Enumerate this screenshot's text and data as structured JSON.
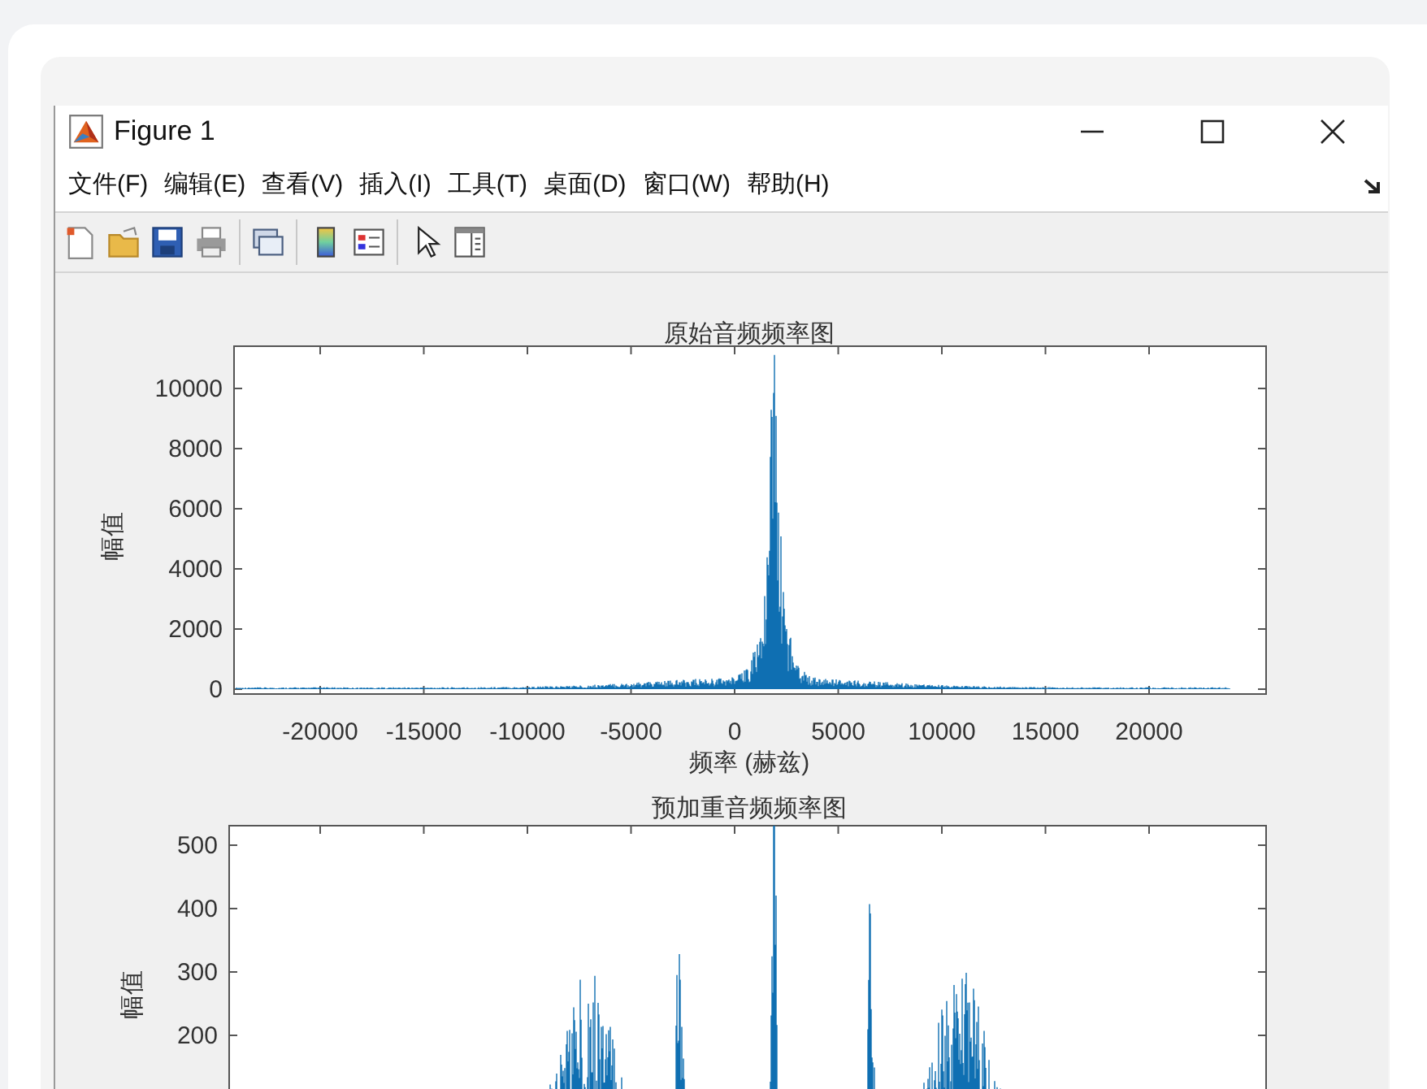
{
  "window": {
    "title": "Figure 1"
  },
  "menu": [
    {
      "label": "文件(F)"
    },
    {
      "label": "编辑(E)"
    },
    {
      "label": "查看(V)"
    },
    {
      "label": "插入(I)"
    },
    {
      "label": "工具(T)"
    },
    {
      "label": "桌面(D)"
    },
    {
      "label": "窗口(W)"
    },
    {
      "label": "帮助(H)"
    }
  ],
  "plots": [
    {
      "kind": "original",
      "title": "原始音频频率图",
      "ylabel": "幅值",
      "xlabel": "频率 (赫兹)",
      "yticks": [
        "10000",
        "8000",
        "6000",
        "4000",
        "2000",
        "0"
      ],
      "xticks": [
        "-20000",
        "-15000",
        "-10000",
        "-5000",
        "0",
        "5000",
        "10000",
        "15000",
        "20000"
      ]
    },
    {
      "kind": "preemphasis",
      "title": "预加重音频频率图",
      "ylabel": "幅值",
      "yticks": [
        "500",
        "400",
        "300",
        "200"
      ]
    }
  ]
}
